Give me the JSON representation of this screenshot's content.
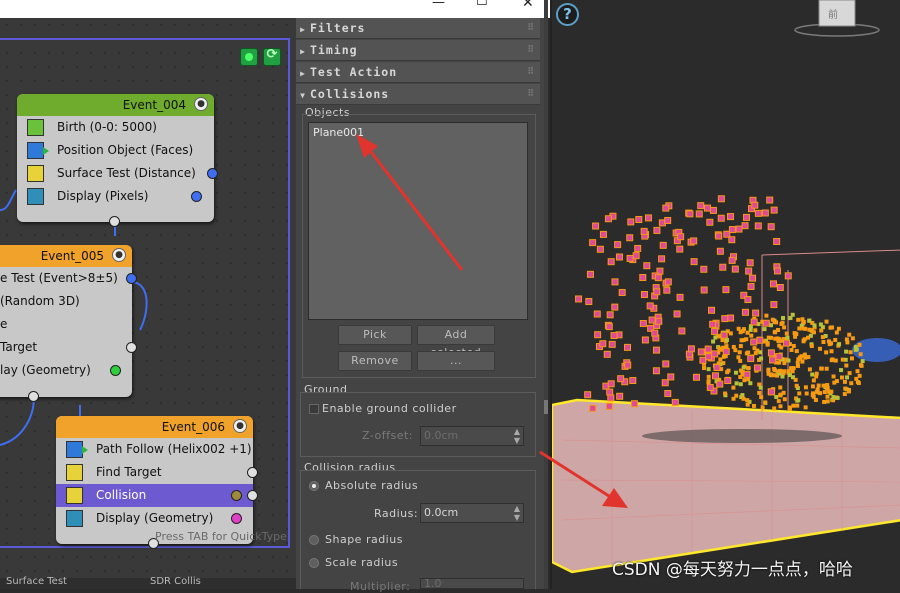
{
  "window": {
    "title_bar_icons": [
      "minimize-icon",
      "maximize-icon",
      "close-icon"
    ]
  },
  "editor": {
    "quicktype_hint": "Press TAB for QuickType",
    "bottom_items": [
      "Surface Test",
      "SDR Collis"
    ],
    "events": [
      {
        "name": "Event_004",
        "header_color": "#6fac2e",
        "operators": [
          "Birth (0-0: 5000)",
          "Position Object (Faces)",
          "Surface Test (Distance)",
          "Display (Pixels)"
        ]
      },
      {
        "name": "Event_005",
        "header_color": "#f0a22a",
        "operators": [
          "e Test (Event>8±5)",
          "(Random 3D)",
          "e",
          "Target",
          "lay (Geometry)"
        ]
      },
      {
        "name": "Event_006",
        "header_color": "#f0a22a",
        "operators": [
          "Path Follow (Helix002 +1)",
          "Find Target",
          "Collision",
          "Display (Geometry)"
        ],
        "selected_index": 2
      }
    ]
  },
  "panel": {
    "rollouts": [
      {
        "label": "Filters",
        "expanded": false
      },
      {
        "label": "Timing",
        "expanded": false
      },
      {
        "label": "Test Action",
        "expanded": false
      },
      {
        "label": "Collisions",
        "expanded": true
      }
    ],
    "objects_label": "Objects",
    "objects_list": [
      "Plane001"
    ],
    "buttons": {
      "pick": "Pick",
      "add_selected": "Add selected",
      "remove": "Remove",
      "more": "..."
    },
    "ground": {
      "label": "Ground",
      "enable_label": "Enable ground collider",
      "enabled": false,
      "zoffset_label": "Z-offset:",
      "zoffset_value": "0.0cm"
    },
    "collision_radius": {
      "label": "Collision radius",
      "options": [
        "Absolute radius",
        "Shape radius",
        "Scale radius"
      ],
      "selected": "Absolute radius",
      "radius_label": "Radius:",
      "radius_value": "0.0cm",
      "multiplier_label": "Multiplier:",
      "multiplier_value": "1.0"
    }
  },
  "viewport": {
    "help_glyph": "?",
    "watermark": "CSDN @每天努力一点点，哈哈"
  },
  "colors": {
    "accent_selection": "#6d5ad0",
    "annotation_arrow": "#e0342c",
    "ground_plane": "#cda4a4",
    "particles_pink": "#e0489a",
    "particles_orange": "#f59a12"
  }
}
